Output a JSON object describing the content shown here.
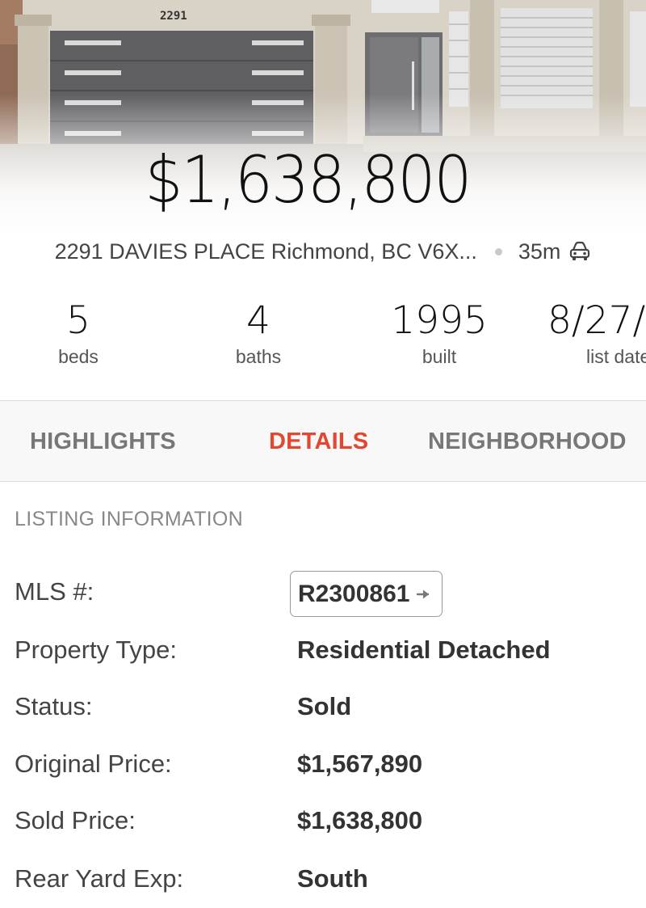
{
  "listing": {
    "price": "$1,638,800",
    "address": "2291 DAVIES PLACE Richmond, BC V6X...",
    "drive_time": "35m",
    "drive_icon": "car-icon",
    "house_number_sign": "2291"
  },
  "stats": [
    {
      "value": "5",
      "label": "beds"
    },
    {
      "value": "4",
      "label": "baths"
    },
    {
      "value": "1995",
      "label": "built"
    },
    {
      "value": "8/27/",
      "label": "list date"
    }
  ],
  "tabs": [
    {
      "label": "HIGHLIGHTS",
      "active": false
    },
    {
      "label": "DETAILS",
      "active": true
    },
    {
      "label": "NEIGHBORHOOD",
      "active": false
    }
  ],
  "listing_information": {
    "title": "LISTING INFORMATION",
    "rows": [
      {
        "key": "MLS #:",
        "value": "R2300861",
        "link": true
      },
      {
        "key": "Property Type:",
        "value": "Residential Detached"
      },
      {
        "key": "Status:",
        "value": "Sold"
      },
      {
        "key": "Original Price:",
        "value": "$1,567,890"
      },
      {
        "key": "Sold Price:",
        "value": "$1,638,800"
      },
      {
        "key": "Rear Yard Exp:",
        "value": "South"
      }
    ]
  },
  "colors": {
    "accent": "#e4462f",
    "tab_inactive": "#777777",
    "tab_bar_bg": "#f8f8f8"
  }
}
